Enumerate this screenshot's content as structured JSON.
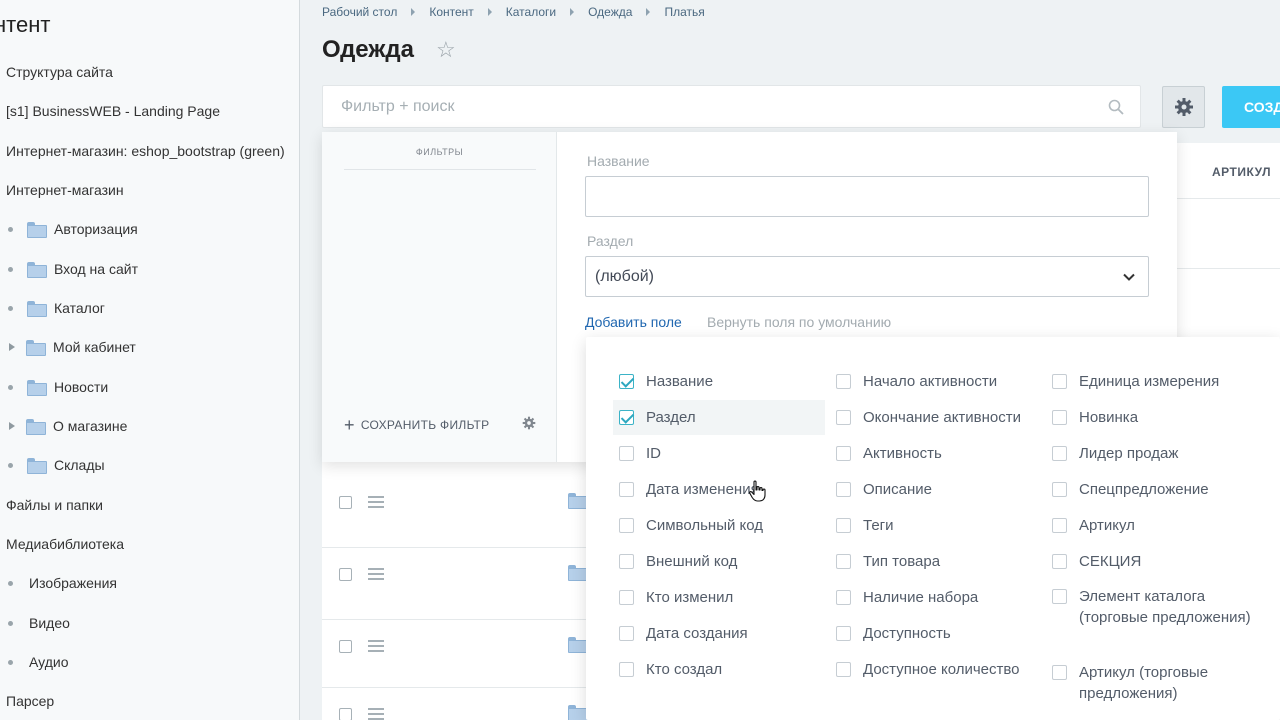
{
  "sidebar": {
    "title": "нтент",
    "items": [
      {
        "label": "Структура сайта",
        "kind": "plain"
      },
      {
        "label": "[s1] BusinessWEB - Landing Page",
        "kind": "plain"
      },
      {
        "label": "Интернет-магазин: eshop_bootstrap (green)",
        "kind": "plain"
      },
      {
        "label": "Интернет-магазин",
        "kind": "plain"
      },
      {
        "label": "Авторизация",
        "kind": "folder",
        "marker": "bullet"
      },
      {
        "label": "Вход на сайт",
        "kind": "folder",
        "marker": "bullet"
      },
      {
        "label": "Каталог",
        "kind": "folder",
        "marker": "bullet"
      },
      {
        "label": "Мой кабинет",
        "kind": "folder",
        "marker": "arrow"
      },
      {
        "label": "Новости",
        "kind": "folder",
        "marker": "bullet"
      },
      {
        "label": "О магазине",
        "kind": "folder",
        "marker": "arrow"
      },
      {
        "label": "Склады",
        "kind": "folder",
        "marker": "bullet"
      },
      {
        "label": "Файлы и папки",
        "kind": "plain"
      },
      {
        "label": "Медиабиблиотека",
        "kind": "plain"
      },
      {
        "label": "Изображения",
        "kind": "bullet"
      },
      {
        "label": "Видео",
        "kind": "bullet"
      },
      {
        "label": "Аудио",
        "kind": "bullet"
      },
      {
        "label": "Парсер",
        "kind": "plain"
      }
    ]
  },
  "breadcrumb": [
    "Рабочий стол",
    "Контент",
    "Каталоги",
    "Одежда",
    "Платья"
  ],
  "page_title": "Одежда",
  "search": {
    "placeholder": "Фильтр + поиск"
  },
  "create_button": "СОЗД",
  "grid": {
    "column_header": "АРТИКУЛ"
  },
  "filter": {
    "panel_title": "ФИЛЬТРЫ",
    "save_filter": "СОХРАНИТЬ ФИЛЬТР",
    "name_label": "Название",
    "name_value": "",
    "section_label": "Раздел",
    "section_value": "(любой)",
    "add_field": "Добавить поле",
    "reset_fields": "Вернуть поля по умолчанию"
  },
  "fields": [
    [
      {
        "label": "Название",
        "checked": true
      },
      {
        "label": "Раздел",
        "checked": true
      },
      {
        "label": "ID",
        "checked": false
      },
      {
        "label": "Дата изменения",
        "checked": false
      },
      {
        "label": "Символьный код",
        "checked": false
      },
      {
        "label": "Внешний код",
        "checked": false
      },
      {
        "label": "Кто изменил",
        "checked": false
      },
      {
        "label": "Дата создания",
        "checked": false
      },
      {
        "label": "Кто создал",
        "checked": false
      }
    ],
    [
      {
        "label": "Начало активности",
        "checked": false
      },
      {
        "label": "Окончание активности",
        "checked": false
      },
      {
        "label": "Активность",
        "checked": false
      },
      {
        "label": "Описание",
        "checked": false
      },
      {
        "label": "Теги",
        "checked": false
      },
      {
        "label": "Тип товара",
        "checked": false
      },
      {
        "label": "Наличие набора",
        "checked": false
      },
      {
        "label": "Доступность",
        "checked": false
      },
      {
        "label": "Доступное количество",
        "checked": false
      }
    ],
    [
      {
        "label": "Единица измерения",
        "checked": false
      },
      {
        "label": "Новинка",
        "checked": false
      },
      {
        "label": "Лидер продаж",
        "checked": false
      },
      {
        "label": "Спецпредложение",
        "checked": false
      },
      {
        "label": "Артикул",
        "checked": false
      },
      {
        "label": "СЕКЦИЯ",
        "checked": false
      },
      {
        "label": "Элемент каталога (торговые предложения)",
        "checked": false
      },
      {
        "label": "Артикул (торговые предложения)",
        "checked": false
      }
    ]
  ]
}
